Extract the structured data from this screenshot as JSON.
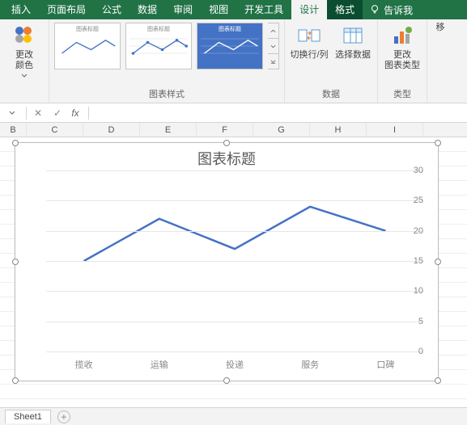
{
  "ribbon_tabs": {
    "insert": "插入",
    "page_layout": "页面布局",
    "formulas": "公式",
    "data": "数据",
    "review": "审阅",
    "view": "视图",
    "developer": "开发工具",
    "design": "设计",
    "format": "格式",
    "tell_me": "告诉我"
  },
  "ribbon": {
    "change_colors": "更改\n颜色",
    "styles_group": "图表样式",
    "switch_row_col": "切换行/列",
    "select_data": "选择数据",
    "data_group": "数据",
    "change_type": "更改\n图表类型",
    "type_group": "类型",
    "move_chart": "移",
    "thumb_title": "图表标题"
  },
  "formula_bar": {
    "fx": "fx",
    "value": ""
  },
  "columns": [
    "B",
    "C",
    "D",
    "E",
    "F",
    "G",
    "H",
    "I"
  ],
  "sheet": {
    "name": "Sheet1"
  },
  "chart_data": {
    "type": "line",
    "title": "图表标题",
    "categories": [
      "揽收",
      "运输",
      "投递",
      "服务",
      "口碑"
    ],
    "values": [
      15,
      22,
      17,
      24,
      20
    ],
    "xlabel": "",
    "ylabel": "",
    "ylim": [
      0,
      30
    ],
    "yticks": [
      0,
      5,
      10,
      15,
      20,
      25,
      30
    ]
  }
}
